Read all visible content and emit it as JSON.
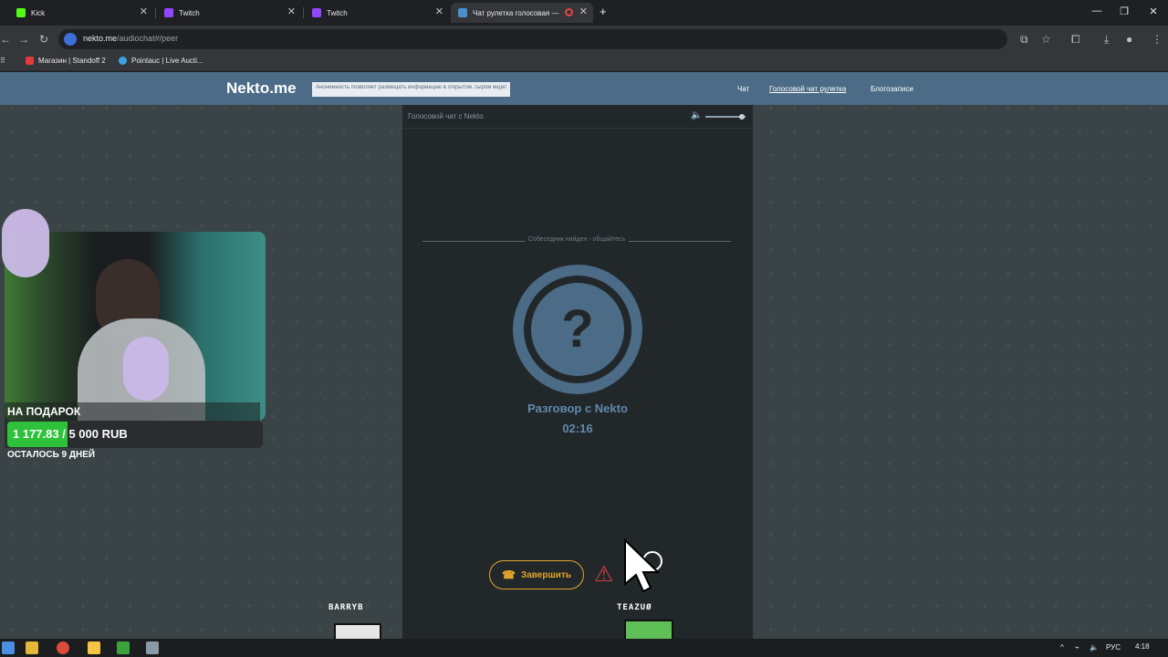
{
  "browser": {
    "tabs": [
      {
        "label": "Kick",
        "color": "#53fc18"
      },
      {
        "label": "Twitch",
        "color": "#9146ff"
      },
      {
        "label": "Twitch",
        "color": "#9146ff"
      },
      {
        "label": "Чат рулетка голосовая —",
        "color": "#4b8fd1"
      }
    ],
    "url_domain": "nekto.me",
    "url_path": "/audiochat#/peer",
    "bookmarks": [
      {
        "label": "Магазин | Standoff 2",
        "color": "#e23b3b"
      },
      {
        "label": "Pointauc | Live Aucti...",
        "color": "#3ba2e2"
      }
    ]
  },
  "site": {
    "logo": "Nekto.me",
    "notice": "Анонимность позволяет размещать информацию в открытом, сыром виде!",
    "nav": [
      "Чат",
      "Голосовой чат рулетка",
      "Блогозаписи"
    ],
    "brand_color": "#4b6b86"
  },
  "chat": {
    "panel_title": "Голосовой чат с Nekto",
    "status": "Собеседник найден - общайтесь",
    "avatar_symbol": "?",
    "conversation_label": "Разговор с Nekto",
    "timer": "02:16",
    "end_button": "Завершить",
    "volume_level": 0.9
  },
  "overlay": {
    "gift_title": "НА ПОДАРОК",
    "gift_amount": "1 177.83 / 5 000 RUB",
    "gift_progress": 0.2356,
    "gift_days": "ОСТАЛОСЬ 9 ДНЕЙ",
    "bot_names": [
      "BARRYB",
      "TEAZUØ"
    ]
  },
  "taskbar": {
    "lang": "РУС",
    "time": "4:18"
  }
}
